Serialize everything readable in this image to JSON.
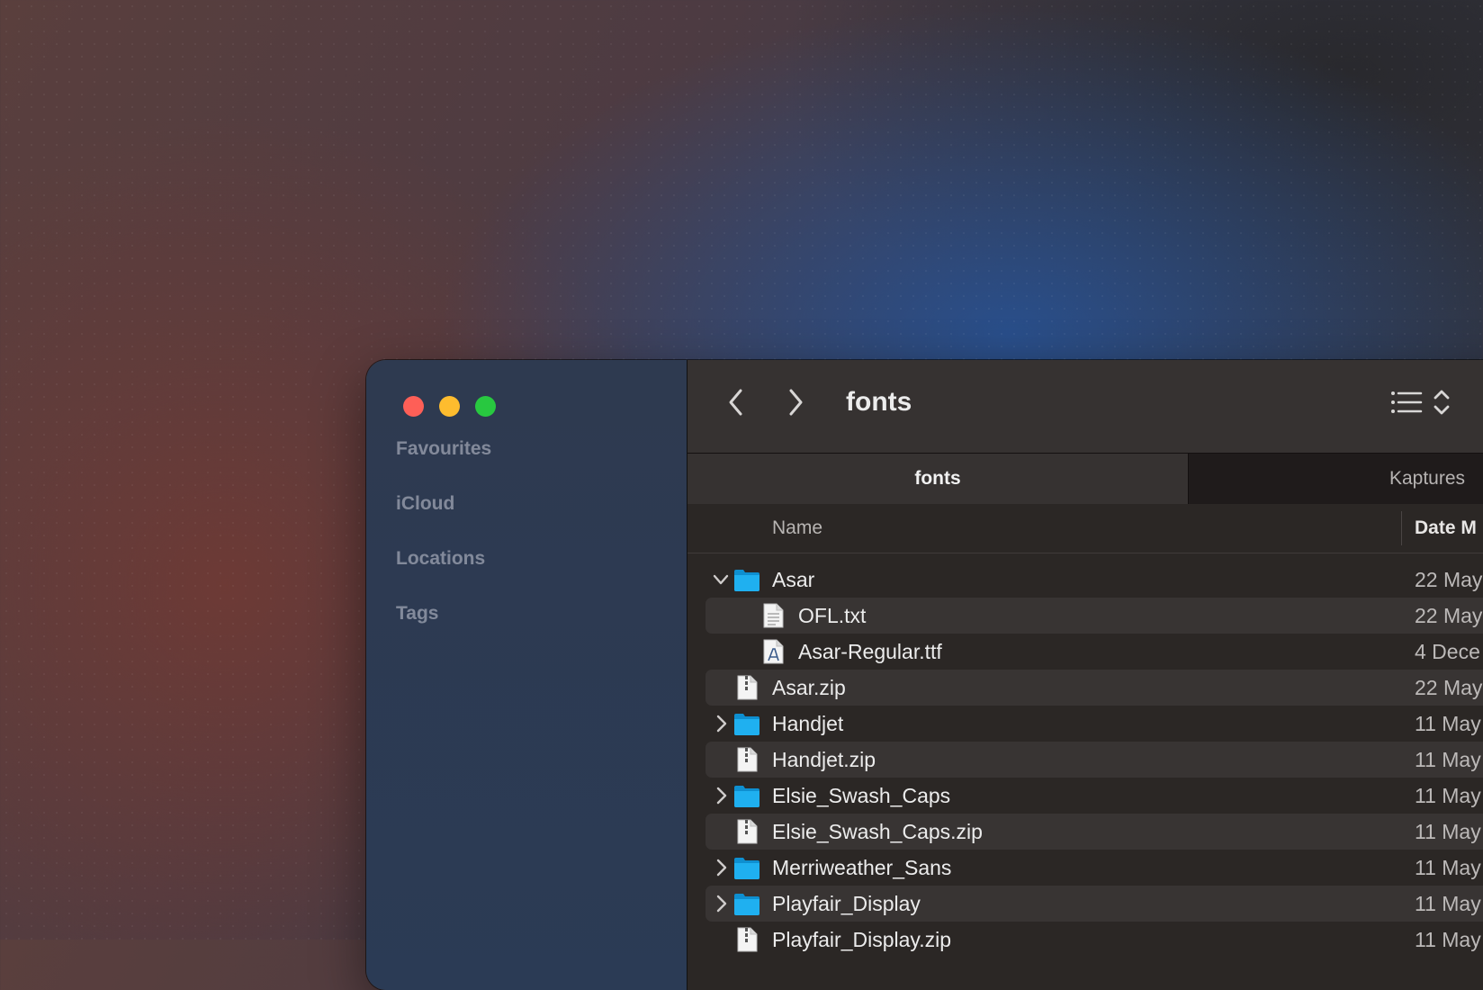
{
  "window": {
    "title": "fonts",
    "controls": {
      "close": "close-button",
      "minimize": "minimize-button",
      "zoom": "zoom-button"
    }
  },
  "sidebar": {
    "sections": [
      "Favourites",
      "iCloud",
      "Locations",
      "Tags"
    ]
  },
  "toolbar": {
    "back_icon": "chevron-left-icon",
    "forward_icon": "chevron-right-icon",
    "view_icon": "list-view-icon"
  },
  "tabs": [
    {
      "label": "fonts",
      "active": true
    },
    {
      "label": "Kaptures",
      "active": false
    }
  ],
  "columns": {
    "name": "Name",
    "date": "Date M"
  },
  "files": [
    {
      "name": "Asar",
      "kind": "folder",
      "date": "22 May",
      "indent": 0,
      "disclosure": "expanded"
    },
    {
      "name": "OFL.txt",
      "kind": "text",
      "date": "22 May",
      "indent": 1,
      "disclosure": "none"
    },
    {
      "name": "Asar-Regular.ttf",
      "kind": "font",
      "date": "4 Dece",
      "indent": 1,
      "disclosure": "none"
    },
    {
      "name": "Asar.zip",
      "kind": "zip",
      "date": "22 May",
      "indent": 0,
      "disclosure": "none"
    },
    {
      "name": "Handjet",
      "kind": "folder",
      "date": "11 May",
      "indent": 0,
      "disclosure": "collapsed"
    },
    {
      "name": "Handjet.zip",
      "kind": "zip",
      "date": "11 May",
      "indent": 0,
      "disclosure": "none"
    },
    {
      "name": "Elsie_Swash_Caps",
      "kind": "folder",
      "date": "11 May",
      "indent": 0,
      "disclosure": "collapsed"
    },
    {
      "name": "Elsie_Swash_Caps.zip",
      "kind": "zip",
      "date": "11 May",
      "indent": 0,
      "disclosure": "none"
    },
    {
      "name": "Merriweather_Sans",
      "kind": "folder",
      "date": "11 May",
      "indent": 0,
      "disclosure": "collapsed"
    },
    {
      "name": "Playfair_Display",
      "kind": "folder",
      "date": "11 May",
      "indent": 0,
      "disclosure": "collapsed"
    },
    {
      "name": "Playfair_Display.zip",
      "kind": "zip",
      "date": "11 May",
      "indent": 0,
      "disclosure": "none"
    }
  ],
  "colors": {
    "folder": "#1fb0f0",
    "sidebar_bg": "#2c3a52",
    "traffic_close": "#fe5f57",
    "traffic_min": "#febc2e",
    "traffic_max": "#28c840"
  }
}
